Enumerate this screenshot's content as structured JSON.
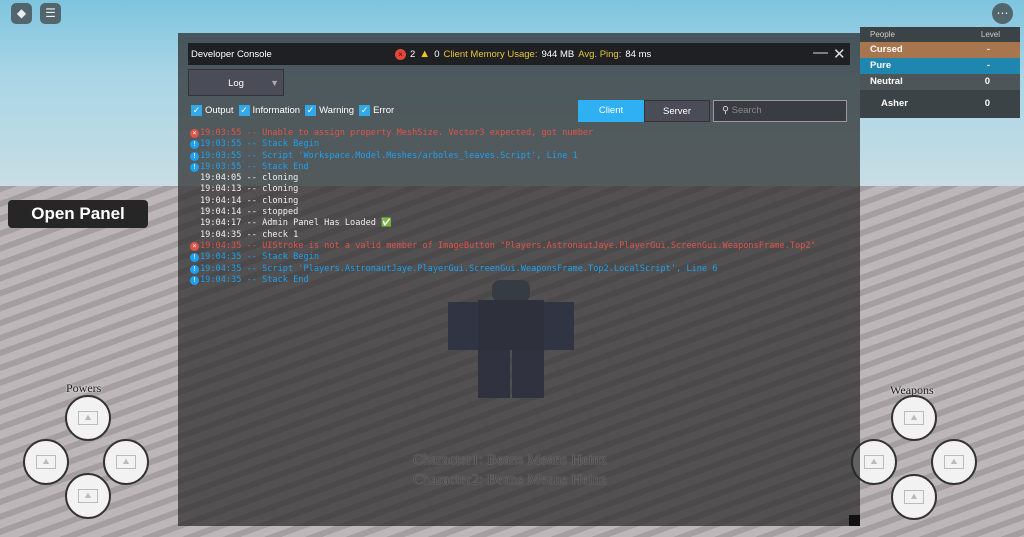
{
  "topbar": {
    "roblox_icon": "roblox-logo-icon",
    "chat_icon": "chat-icon",
    "more_icon": "more-icon"
  },
  "open_panel": "Open Panel",
  "console": {
    "title": "Developer Console",
    "error_count": "2",
    "warning_count": "0",
    "memory_label": "Client Memory Usage:",
    "memory_value": "944 MB",
    "ping_label": "Avg. Ping:",
    "ping_value": "84 ms",
    "minimize": "—",
    "close": "✕",
    "dropdown": "Log",
    "filters": [
      "Output",
      "Information",
      "Warning",
      "Error"
    ],
    "tabs": {
      "client": "Client",
      "server": "Server"
    },
    "search_placeholder": "Search",
    "logs": [
      {
        "type": "e",
        "text": "19:03:55 -- Unable to assign property MeshSize. Vector3 expected, got number"
      },
      {
        "type": "i",
        "text": "19:03:55 -- Stack Begin"
      },
      {
        "type": "i",
        "text": "19:03:55 -- Script 'Workspace.Model.Meshes/arboles_leaves.Script', Line 1"
      },
      {
        "type": "i",
        "text": "19:03:55 -- Stack End"
      },
      {
        "type": "o",
        "text": "19:04:05 -- cloning"
      },
      {
        "type": "o",
        "text": "19:04:13 -- cloning"
      },
      {
        "type": "o",
        "text": "19:04:14 -- cloning"
      },
      {
        "type": "o",
        "text": "19:04:14 -- stopped"
      },
      {
        "type": "o",
        "text": "19:04:17 -- Admin Panel Has Loaded ✅"
      },
      {
        "type": "o",
        "text": "19:04:35 -- check 1"
      },
      {
        "type": "e",
        "text": "19:04:35 -- UIStroke is not a valid member of ImageButton \"Players.AstronautJaye.PlayerGui.ScreenGui.WeaponsFrame.Top2\""
      },
      {
        "type": "i",
        "text": "19:04:35 -- Stack Begin"
      },
      {
        "type": "i",
        "text": "19:04:35 -- Script 'Players.AstronautJaye.PlayerGui.ScreenGui.WeaponsFrame.Top2.LocalScript', Line 6"
      },
      {
        "type": "i",
        "text": "19:04:35 -- Stack End"
      }
    ]
  },
  "captions": [
    "Character1: Beans Means Heinz",
    "Character2: Beans Means Heinz"
  ],
  "players": {
    "header": {
      "people": "People",
      "level": "Level"
    },
    "rows": [
      {
        "name": "Cursed",
        "level": "-",
        "color": "#a8764e"
      },
      {
        "name": "Pure",
        "level": "-",
        "color": "#1f86b0"
      },
      {
        "name": "Neutral",
        "level": "0",
        "color": "#4e5558"
      },
      {
        "name": "Asher",
        "level": "0",
        "color": "#3c4347"
      }
    ]
  },
  "powers_label": "Powers",
  "weapons_label": "Weapons"
}
